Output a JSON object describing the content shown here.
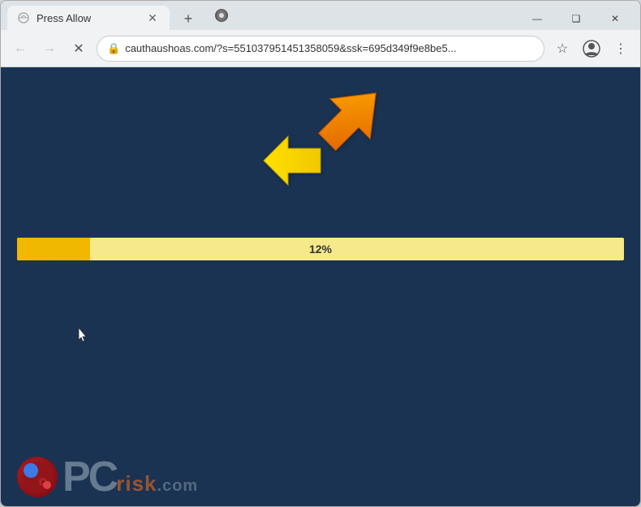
{
  "window": {
    "title": "Press Allow",
    "tab_label": "Press Allow",
    "close_label": "✕",
    "minimize_label": "—",
    "maximize_label": "❑",
    "new_tab_label": "+"
  },
  "toolbar": {
    "back_label": "←",
    "forward_label": "→",
    "reload_label": "✕",
    "url": "cauthaushoas.com/?s=551037951451358059&ssk=695d349f9e8be5...",
    "bookmark_label": "☆",
    "profile_label": "⊙",
    "menu_label": "⋮"
  },
  "page": {
    "progress_percent": 12,
    "progress_label": "12%",
    "progress_fill_width": "12%"
  },
  "watermark": {
    "text_pc": "PC",
    "text_risk": "risk",
    "text_dotcom": ".com"
  },
  "icons": {
    "back": "←",
    "forward": "→",
    "close_tab": "×",
    "lock": "🔒",
    "star": "☆",
    "profile": "👤",
    "menu": "⋮",
    "shield": "⬡",
    "new_tab": "+"
  }
}
